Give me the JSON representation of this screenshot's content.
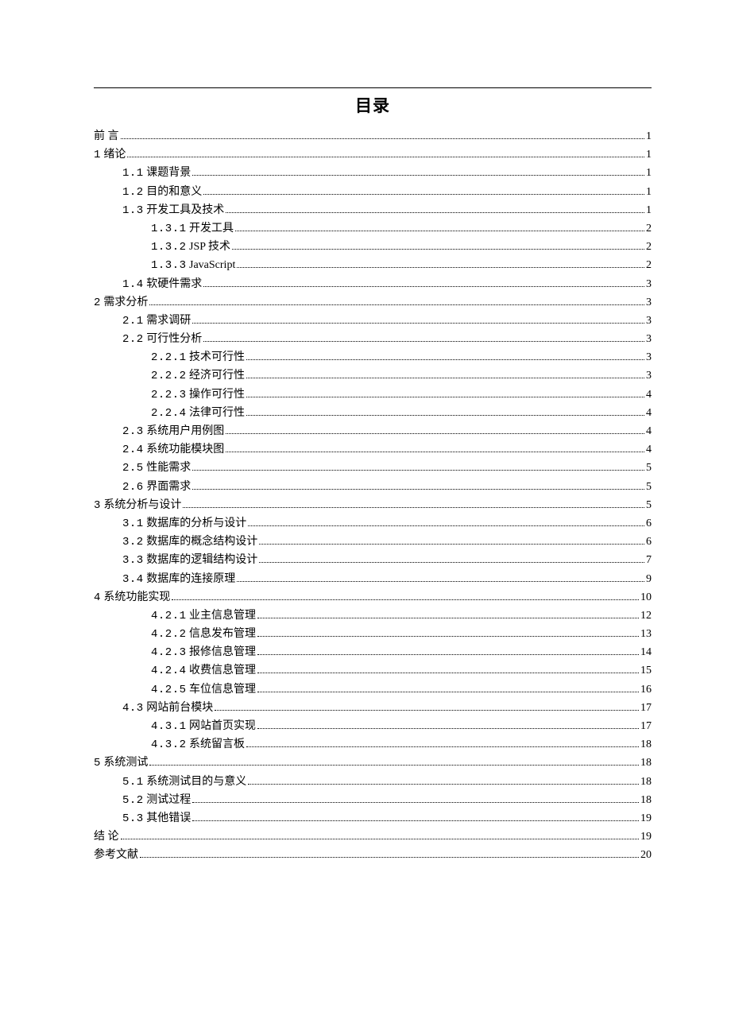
{
  "title": "目录",
  "entries": [
    {
      "level": 0,
      "label": "前 言",
      "page": "1"
    },
    {
      "level": 0,
      "label": "1 绪论",
      "page": "1"
    },
    {
      "level": 1,
      "label": "1.1 课题背景",
      "page": "1"
    },
    {
      "level": 1,
      "label": "1.2 目的和意义",
      "page": "1"
    },
    {
      "level": 1,
      "label": "1.3 开发工具及技术",
      "page": "1"
    },
    {
      "level": 2,
      "label": "1.3.1 开发工具",
      "page": "2"
    },
    {
      "level": 2,
      "label": "1.3.2 JSP 技术",
      "page": "2"
    },
    {
      "level": 2,
      "label": "1.3.3 JavaScript",
      "page": "2"
    },
    {
      "level": 1,
      "label": "1.4 软硬件需求",
      "page": "3"
    },
    {
      "level": 0,
      "label": "2 需求分析",
      "page": "3"
    },
    {
      "level": 1,
      "label": "2.1 需求调研",
      "page": "3"
    },
    {
      "level": 1,
      "label": "2.2 可行性分析",
      "page": "3"
    },
    {
      "level": 2,
      "label": "2.2.1 技术可行性",
      "page": "3"
    },
    {
      "level": 2,
      "label": "2.2.2 经济可行性",
      "page": "3"
    },
    {
      "level": 2,
      "label": "2.2.3 操作可行性",
      "page": "4"
    },
    {
      "level": 2,
      "label": "2.2.4 法律可行性",
      "page": "4"
    },
    {
      "level": 1,
      "label": "2.3 系统用户用例图",
      "page": "4"
    },
    {
      "level": 1,
      "label": "2.4 系统功能模块图",
      "page": "4"
    },
    {
      "level": 1,
      "label": "2.5 性能需求",
      "page": "5"
    },
    {
      "level": 1,
      "label": "2.6 界面需求",
      "page": "5"
    },
    {
      "level": 0,
      "label": "3 系统分析与设计",
      "page": "5"
    },
    {
      "level": 1,
      "label": "3.1 数据库的分析与设计",
      "page": "6"
    },
    {
      "level": 1,
      "label": "3.2 数据库的概念结构设计",
      "page": "6"
    },
    {
      "level": 1,
      "label": "3.3 数据库的逻辑结构设计",
      "page": "7"
    },
    {
      "level": 1,
      "label": "3.4 数据库的连接原理",
      "page": "9"
    },
    {
      "level": 0,
      "label": "4 系统功能实现",
      "page": "10"
    },
    {
      "level": 2,
      "label": "4.2.1 业主信息管理",
      "page": "12"
    },
    {
      "level": 2,
      "label": "4.2.2 信息发布管理",
      "page": "13"
    },
    {
      "level": 2,
      "label": "4.2.3 报修信息管理",
      "page": "14"
    },
    {
      "level": 2,
      "label": "4.2.4 收费信息管理",
      "page": "15"
    },
    {
      "level": 2,
      "label": "4.2.5 车位信息管理",
      "page": "16"
    },
    {
      "level": 1,
      "label": "4.3 网站前台模块",
      "page": "17"
    },
    {
      "level": 2,
      "label": "4.3.1 网站首页实现",
      "page": "17"
    },
    {
      "level": 2,
      "label": "4.3.2 系统留言板",
      "page": "18"
    },
    {
      "level": 0,
      "label": "5 系统测试",
      "page": "18"
    },
    {
      "level": 1,
      "label": "5.1 系统测试目的与意义",
      "page": "18"
    },
    {
      "level": 1,
      "label": "5.2 测试过程",
      "page": "18"
    },
    {
      "level": 1,
      "label": "5.3 其他错误",
      "page": "19"
    },
    {
      "level": 0,
      "label": "结   论",
      "page": "19"
    },
    {
      "level": 0,
      "label": "参考文献",
      "page": "20"
    }
  ]
}
